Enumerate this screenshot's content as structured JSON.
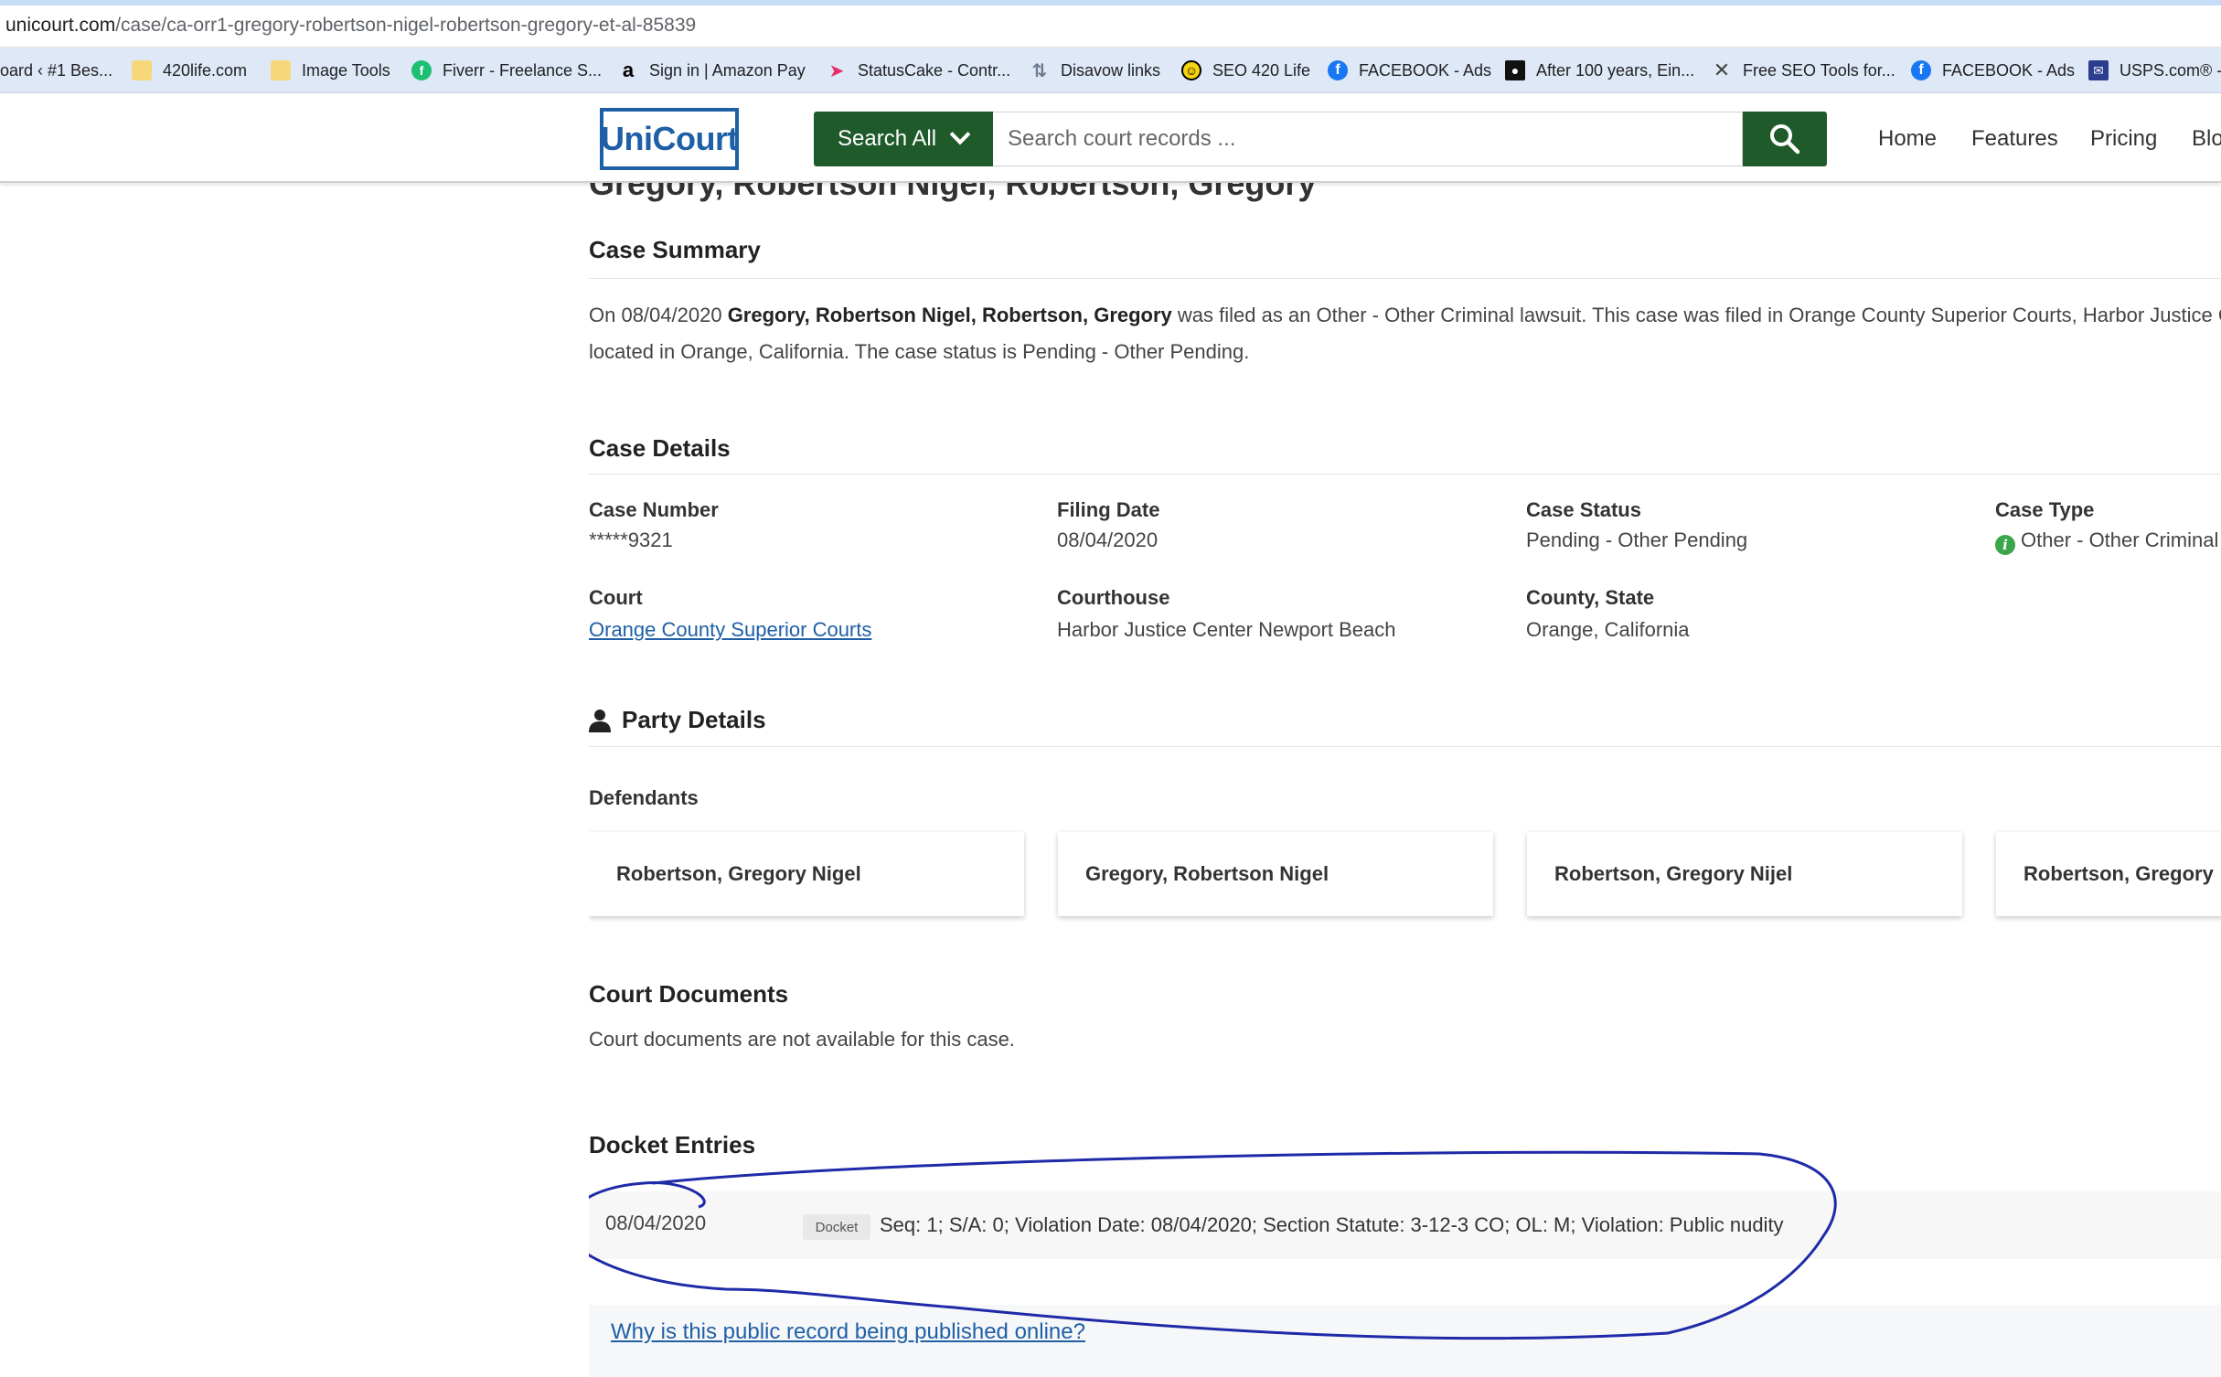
{
  "browser": {
    "url_host": "unicourt.com",
    "url_path": "/case/ca-orr1-gregory-robertson-nigel-robertson-gregory-et-al-85839",
    "bookmarks": [
      {
        "label": "oard ‹ #1 Bes...",
        "icon": "none"
      },
      {
        "label": "420life.com",
        "icon": "folder-icon"
      },
      {
        "label": "Image Tools",
        "icon": "folder-icon"
      },
      {
        "label": "Fiverr - Freelance S...",
        "icon": "fiverr-icon"
      },
      {
        "label": "Sign in | Amazon Pay",
        "icon": "amazon-icon"
      },
      {
        "label": "StatusCake - Contr...",
        "icon": "statuscake-icon"
      },
      {
        "label": "Disavow links",
        "icon": "google-icon"
      },
      {
        "label": "SEO 420 Life",
        "icon": "seo-icon"
      },
      {
        "label": "FACEBOOK - Ads",
        "icon": "facebook-icon"
      },
      {
        "label": "After 100 years, Ein...",
        "icon": "article-icon"
      },
      {
        "label": "Free SEO Tools for...",
        "icon": "x-icon"
      },
      {
        "label": "FACEBOOK - Ads",
        "icon": "facebook-icon"
      },
      {
        "label": "USPS.com® -",
        "icon": "usps-icon"
      }
    ]
  },
  "header": {
    "logo": "UniCourt",
    "search_all_label": "Search All",
    "search_placeholder": "Search court records ...",
    "nav": [
      "Home",
      "Features",
      "Pricing",
      "Blo"
    ],
    "colors": {
      "brand_blue": "#1f5fa6",
      "brand_green": "#1f5a2a"
    }
  },
  "page": {
    "title_fragment": "Gregory, Robertson Nigel, Robertson, Gregory",
    "summary": {
      "heading": "Case Summary",
      "prefix": "On 08/04/2020 ",
      "parties": "Gregory, Robertson Nigel, Robertson, Gregory",
      "line1_rest": " was filed as an Other - Other Criminal lawsuit. This case was filed in Orange County Superior Courts, Harbor Justice C",
      "line2": "located in Orange, California. The case status is Pending - Other Pending."
    },
    "details": {
      "heading": "Case Details",
      "case_number_label": "Case Number",
      "case_number": "*****9321",
      "filing_date_label": "Filing Date",
      "filing_date": "08/04/2020",
      "case_status_label": "Case Status",
      "case_status": "Pending - Other Pending",
      "case_type_label": "Case Type",
      "case_type": "Other - Other Criminal",
      "court_label": "Court",
      "court": "Orange County Superior Courts",
      "courthouse_label": "Courthouse",
      "courthouse": "Harbor Justice Center Newport Beach",
      "county_label": "County, State",
      "county": "Orange, California"
    },
    "party": {
      "heading": "Party Details",
      "defendants_label": "Defendants",
      "defendants": [
        "Robertson, Gregory Nigel",
        "Gregory, Robertson Nigel",
        "Robertson, Gregory Nijel",
        "Robertson, Gregory"
      ]
    },
    "documents": {
      "heading": "Court Documents",
      "text": "Court documents are not available for this case."
    },
    "docket": {
      "heading": "Docket Entries",
      "entries": [
        {
          "date": "08/04/2020",
          "tag": "Docket",
          "text": "Seq: 1; S/A: 0; Violation Date: 08/04/2020; Section Statute: 3-12-3 CO; OL: M; Violation: Public nudity"
        }
      ]
    },
    "why_link": "Why is this public record being published online?"
  }
}
